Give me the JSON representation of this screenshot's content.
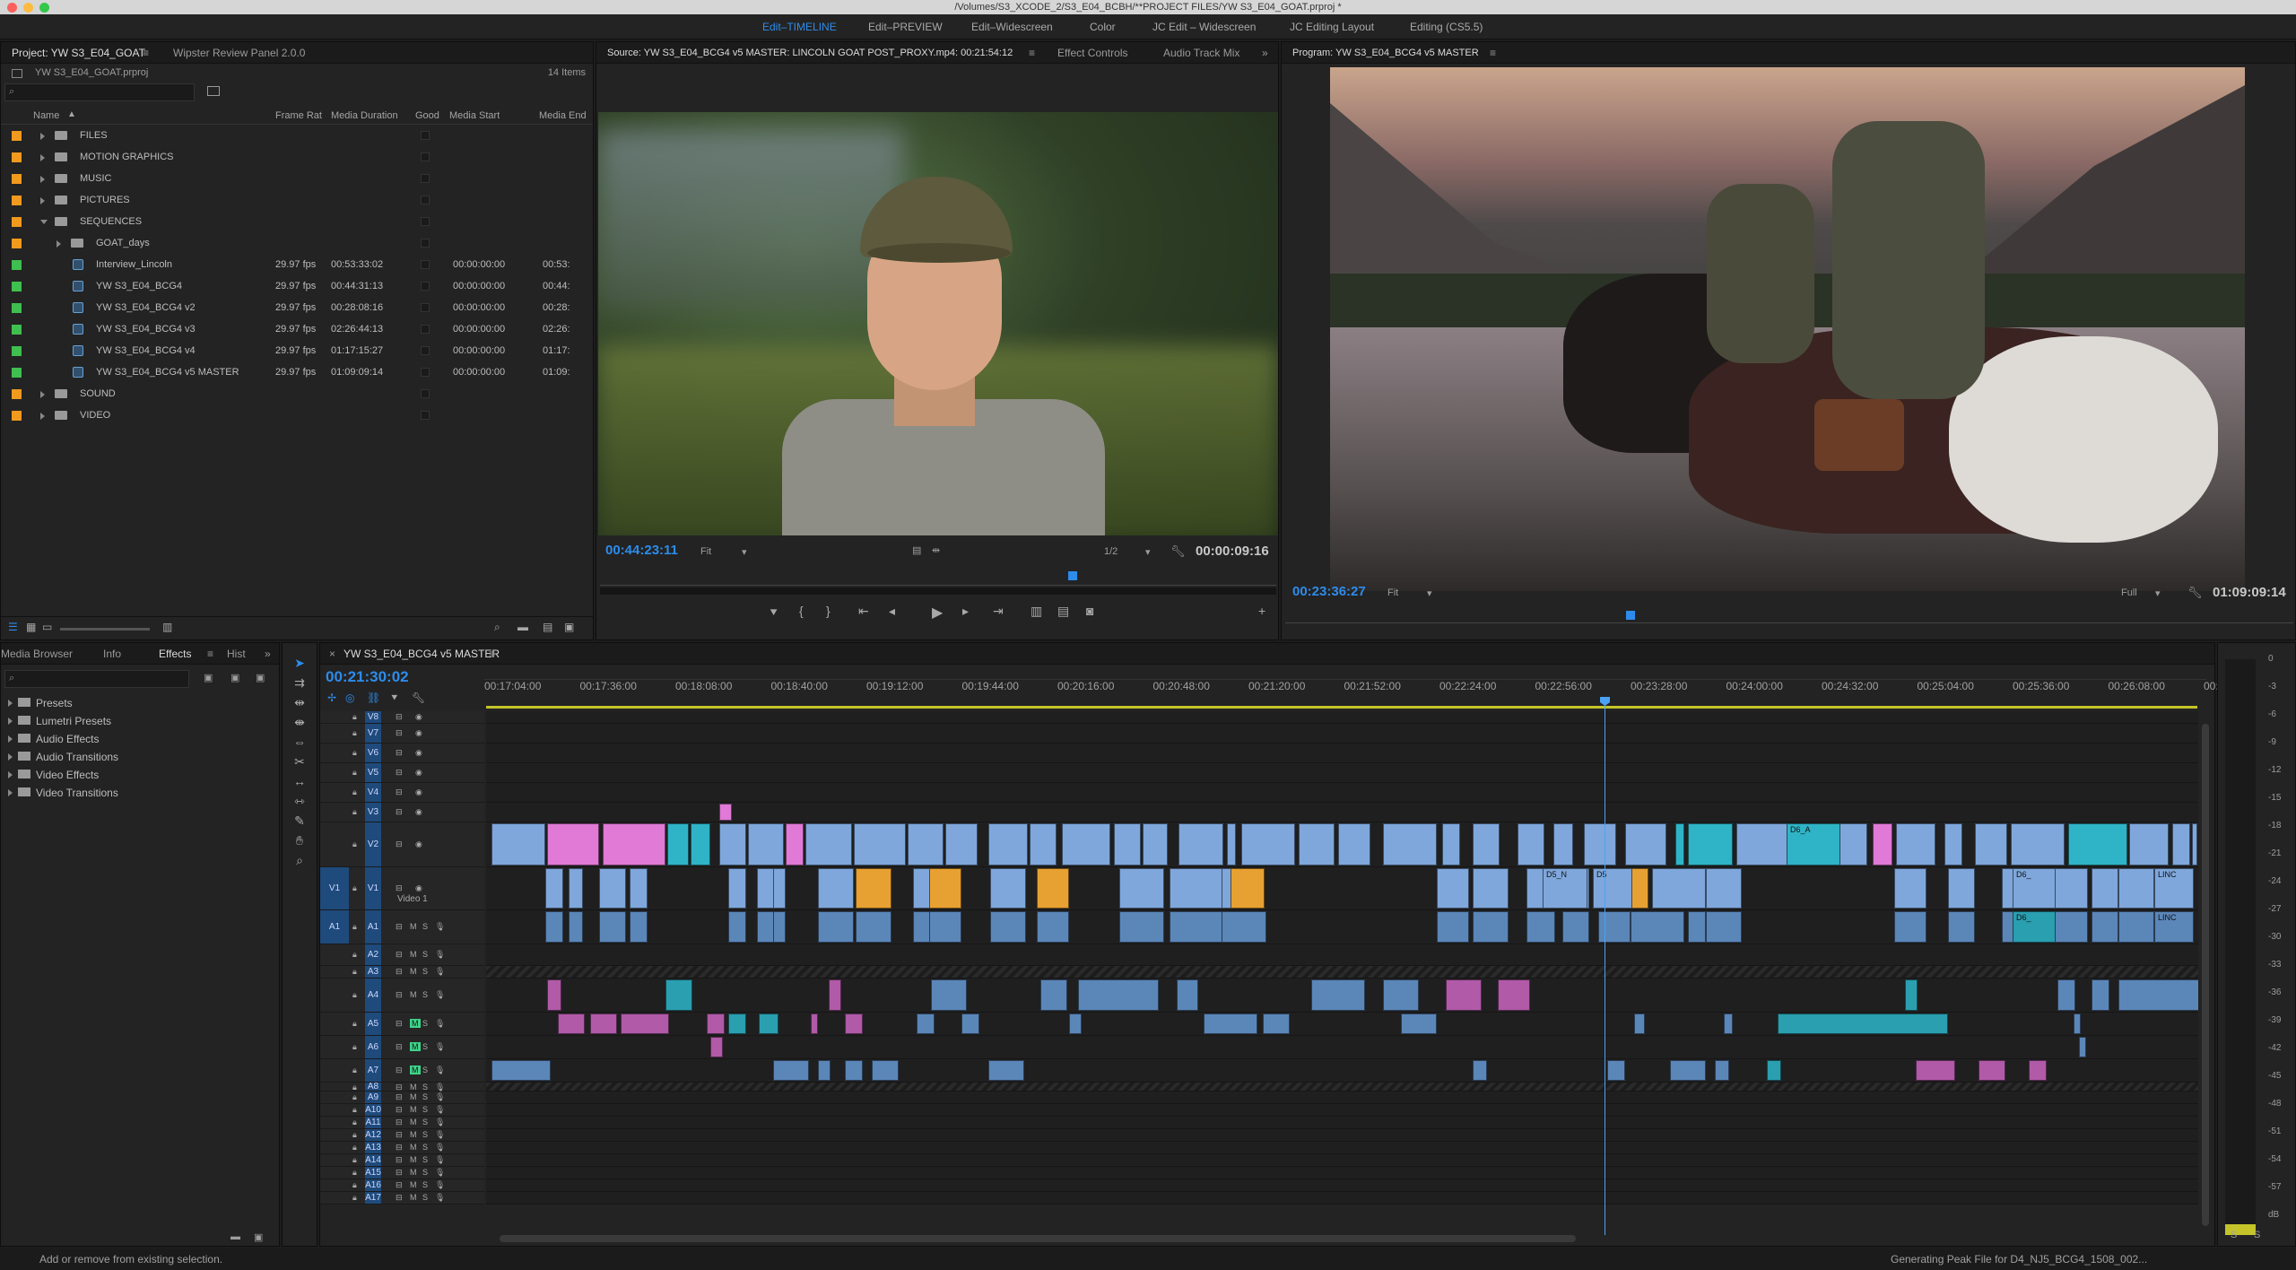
{
  "titlebar": {
    "text": "/Volumes/S3_XCODE_2/S3_E04_BCBH/**PROJECT FILES/YW S3_E04_GOAT.prproj *"
  },
  "workspaces": [
    {
      "label": "Edit–TIMELINE",
      "active": true
    },
    {
      "label": "Edit–PREVIEW"
    },
    {
      "label": "Edit–Widescreen"
    },
    {
      "label": "Color"
    },
    {
      "label": "JC Edit – Widescreen"
    },
    {
      "label": "JC Editing Layout"
    },
    {
      "label": "Editing (CS5.5)"
    }
  ],
  "project": {
    "tab": "Project: YW S3_E04_GOAT",
    "tab2": "Wipster Review Panel 2.0.0",
    "filename": "YW S3_E04_GOAT.prproj",
    "count": "14 Items",
    "columns": {
      "name": "Name",
      "rate": "Frame Rat",
      "duration": "Media Duration",
      "good": "Good",
      "start": "Media Start",
      "end": "Media End"
    },
    "rows": [
      {
        "name": "FILES",
        "rate": "",
        "duration": "",
        "start": "",
        "end": "",
        "color": "#f29a1e",
        "type": "folder",
        "depth": 0
      },
      {
        "name": "MOTION GRAPHICS",
        "rate": "",
        "duration": "",
        "start": "",
        "end": "",
        "color": "#f29a1e",
        "type": "folder",
        "depth": 0
      },
      {
        "name": "MUSIC",
        "rate": "",
        "duration": "",
        "start": "",
        "end": "",
        "color": "#f29a1e",
        "type": "folder",
        "depth": 0
      },
      {
        "name": "PICTURES",
        "rate": "",
        "duration": "",
        "start": "",
        "end": "",
        "color": "#f29a1e",
        "type": "folder",
        "depth": 0
      },
      {
        "name": "SEQUENCES",
        "rate": "",
        "duration": "",
        "start": "",
        "end": "",
        "color": "#f29a1e",
        "type": "folder-open",
        "depth": 0
      },
      {
        "name": "GOAT_days",
        "rate": "",
        "duration": "",
        "start": "",
        "end": "",
        "color": "#f29a1e",
        "type": "folder",
        "depth": 1
      },
      {
        "name": "Interview_Lincoln",
        "rate": "29.97 fps",
        "duration": "00:53:33:02",
        "start": "00:00:00:00",
        "end": "00:53:",
        "color": "#3fbf4f",
        "type": "sequence",
        "depth": 1
      },
      {
        "name": "YW S3_E04_BCG4",
        "rate": "29.97 fps",
        "duration": "00:44:31:13",
        "start": "00:00:00:00",
        "end": "00:44:",
        "color": "#3fbf4f",
        "type": "sequence",
        "depth": 1
      },
      {
        "name": "YW S3_E04_BCG4 v2",
        "rate": "29.97 fps",
        "duration": "00:28:08:16",
        "start": "00:00:00:00",
        "end": "00:28:",
        "color": "#3fbf4f",
        "type": "sequence",
        "depth": 1
      },
      {
        "name": "YW S3_E04_BCG4 v3",
        "rate": "29.97 fps",
        "duration": "02:26:44:13",
        "start": "00:00:00:00",
        "end": "02:26:",
        "color": "#3fbf4f",
        "type": "sequence",
        "depth": 1
      },
      {
        "name": "YW S3_E04_BCG4 v4",
        "rate": "29.97 fps",
        "duration": "01:17:15:27",
        "start": "00:00:00:00",
        "end": "01:17:",
        "color": "#3fbf4f",
        "type": "sequence",
        "depth": 1
      },
      {
        "name": "YW S3_E04_BCG4 v5 MASTER",
        "rate": "29.97 fps",
        "duration": "01:09:09:14",
        "start": "00:00:00:00",
        "end": "01:09:",
        "color": "#3fbf4f",
        "type": "sequence",
        "depth": 1
      },
      {
        "name": "SOUND",
        "rate": "",
        "duration": "",
        "start": "",
        "end": "",
        "color": "#f29a1e",
        "type": "folder",
        "depth": 0
      },
      {
        "name": "VIDEO",
        "rate": "",
        "duration": "",
        "start": "",
        "end": "",
        "color": "#f29a1e",
        "type": "folder",
        "depth": 0
      }
    ]
  },
  "source": {
    "tab": "Source: YW S3_E04_BCG4 v5 MASTER: LINCOLN GOAT POST_PROXY.mp4: 00:21:54:12",
    "tab2": "Effect Controls",
    "tab3": "Audio Track Mix",
    "timecode": "00:44:23:11",
    "fit": "Fit",
    "resolution": "1/2",
    "duration": "00:00:09:16"
  },
  "program": {
    "tab": "Program: YW S3_E04_BCG4 v5 MASTER",
    "timecode": "00:23:36:27",
    "fit": "Fit",
    "resolution": "Full",
    "duration": "01:09:09:14"
  },
  "effects": {
    "tabs": [
      "Media Browser",
      "Info",
      "Effects",
      "Hist"
    ],
    "items": [
      "Presets",
      "Lumetri Presets",
      "Audio Effects",
      "Audio Transitions",
      "Video Effects",
      "Video Transitions"
    ]
  },
  "timeline": {
    "tab": "YW S3_E04_BCG4 v5 MASTER",
    "timecode": "00:21:30:02",
    "ruler": [
      "00:17:04:00",
      "00:17:36:00",
      "00:18:08:00",
      "00:18:40:00",
      "00:19:12:00",
      "00:19:44:00",
      "00:20:16:00",
      "00:20:48:00",
      "00:21:20:00",
      "00:21:52:00",
      "00:22:24:00",
      "00:22:56:00",
      "00:23:28:00",
      "00:24:00:00",
      "00:24:32:00",
      "00:25:04:00",
      "00:25:36:00",
      "00:26:08:00",
      "00:2"
    ],
    "video_tracks": [
      "V8",
      "V7",
      "V6",
      "V5",
      "V4",
      "V3",
      "V2",
      "V1"
    ],
    "v1_label": "Video 1",
    "audio_tracks": [
      "A1",
      "A2",
      "A3",
      "A4",
      "A5",
      "A6",
      "A7",
      "A8",
      "A9",
      "A10",
      "A11",
      "A12",
      "A13",
      "A14",
      "A15",
      "A16",
      "A17"
    ],
    "src_v": "V1",
    "src_a": "A1",
    "clip_labels": {
      "d6": "D6_A",
      "d5": "D5_N",
      "d5b": "D5",
      "linc": "LINC",
      "d6b": "D6_"
    }
  },
  "meter": {
    "scale": [
      "0",
      "-3",
      "-6",
      "-9",
      "-12",
      "-15",
      "-18",
      "-21",
      "-24",
      "-27",
      "-30",
      "-33",
      "-36",
      "-39",
      "-42",
      "-45",
      "-48",
      "-51",
      "-54",
      "-57",
      "dB"
    ],
    "bottom": [
      "S",
      "S"
    ]
  },
  "status": {
    "left": "Add or remove from existing selection.",
    "right": "Generating Peak File for D4_NJ5_BCG4_1508_002..."
  },
  "colors": {
    "accent": "#2d8ceb",
    "video_clip": "#7fa7db",
    "pink_clip": "#e07ad6",
    "cyan_clip": "#2fb4c7",
    "orange_clip": "#e7a132"
  }
}
